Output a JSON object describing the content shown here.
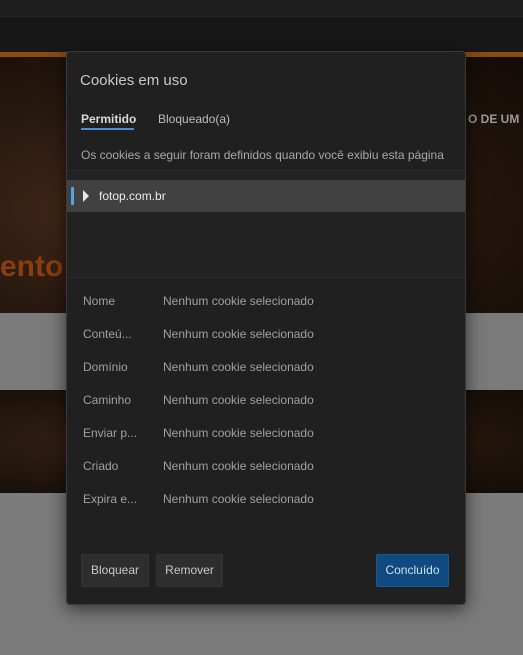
{
  "background": {
    "hero_text": "ento",
    "hero_right_text": "O DE UM F"
  },
  "dialog": {
    "title": "Cookies em uso",
    "tabs": [
      {
        "label": "Permitido",
        "active": true
      },
      {
        "label": "Bloqueado(a)",
        "active": false
      }
    ],
    "description": "Os cookies a seguir foram definidos quando você exibiu esta página",
    "tree": {
      "items": [
        {
          "label": "fotop.com.br",
          "expanded": false,
          "selected": true
        }
      ]
    },
    "properties": [
      {
        "name": "Nome",
        "value": "Nenhum cookie selecionado"
      },
      {
        "name": "Conteú...",
        "value": "Nenhum cookie selecionado"
      },
      {
        "name": "Domínio",
        "value": "Nenhum cookie selecionado"
      },
      {
        "name": "Caminho",
        "value": "Nenhum cookie selecionado"
      },
      {
        "name": "Enviar p...",
        "value": "Nenhum cookie selecionado"
      },
      {
        "name": "Criado",
        "value": "Nenhum cookie selecionado"
      },
      {
        "name": "Expira e...",
        "value": "Nenhum cookie selecionado"
      }
    ],
    "buttons": {
      "block": "Bloquear",
      "remove": "Remover",
      "done": "Concluído"
    }
  },
  "colors": {
    "accent": "#4a8fd8",
    "primary_button": "#104a80",
    "dialog_bg": "#202020",
    "selected_row": "#414141"
  }
}
